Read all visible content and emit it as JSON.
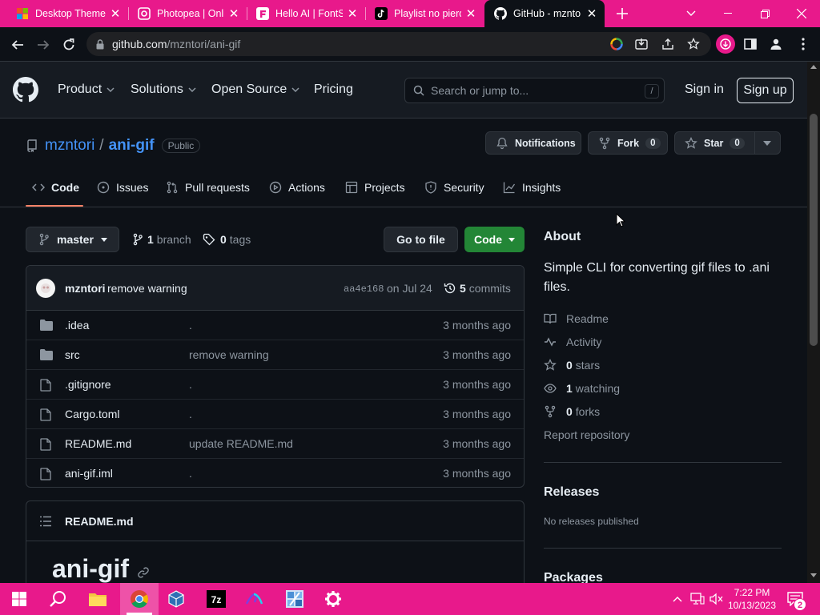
{
  "browser": {
    "tabs": [
      {
        "title": "Desktop Theme",
        "icon": "microsoft-icon"
      },
      {
        "title": "Photopea | Onli",
        "icon": "photopea-icon"
      },
      {
        "title": "Hello AI | FontSl",
        "icon": "fontspace-icon"
      },
      {
        "title": "Playlist no pierd",
        "icon": "tiktok-icon"
      },
      {
        "title": "GitHub - mznto",
        "icon": "github-icon",
        "active": true
      }
    ],
    "url_host": "github.com",
    "url_path": "/mzntori/ani-gif"
  },
  "gh_header": {
    "nav": [
      "Product",
      "Solutions",
      "Open Source",
      "Pricing"
    ],
    "search_placeholder": "Search or jump to...",
    "search_key": "/",
    "sign_in": "Sign in",
    "sign_up": "Sign up"
  },
  "repo": {
    "owner": "mzntori",
    "separator": "/",
    "name": "ani-gif",
    "visibility": "Public",
    "notifications_label": "Notifications",
    "fork_label": "Fork",
    "fork_count": "0",
    "star_label": "Star",
    "star_count": "0",
    "tabs": [
      "Code",
      "Issues",
      "Pull requests",
      "Actions",
      "Projects",
      "Security",
      "Insights"
    ]
  },
  "files": {
    "branch": "master",
    "branch_count": "1",
    "branch_label": "branch",
    "tag_count": "0",
    "tag_label": "tags",
    "go_to_file": "Go to file",
    "code_button": "Code",
    "commit": {
      "author": "mzntori",
      "message": "remove warning",
      "hash": "aa4e168",
      "date": "on Jul 24",
      "count": "5",
      "count_label": "commits"
    },
    "rows": [
      {
        "type": "folder",
        "name": ".idea",
        "message": ".",
        "age": "3 months ago"
      },
      {
        "type": "folder",
        "name": "src",
        "message": "remove warning",
        "age": "3 months ago"
      },
      {
        "type": "file",
        "name": ".gitignore",
        "message": ".",
        "age": "3 months ago"
      },
      {
        "type": "file",
        "name": "Cargo.toml",
        "message": ".",
        "age": "3 months ago"
      },
      {
        "type": "file",
        "name": "README.md",
        "message": "update README.md",
        "age": "3 months ago"
      },
      {
        "type": "file",
        "name": "ani-gif.iml",
        "message": ".",
        "age": "3 months ago"
      }
    ],
    "readme_file": "README.md",
    "readme_title": "ani-gif"
  },
  "about": {
    "heading": "About",
    "description": "Simple CLI for converting gif files to .ani files.",
    "readme": "Readme",
    "activity": "Activity",
    "stars_count": "0",
    "stars_label": "stars",
    "watching_count": "1",
    "watching_label": "watching",
    "forks_count": "0",
    "forks_label": "forks",
    "report": "Report repository",
    "releases_heading": "Releases",
    "releases_text": "No releases published",
    "packages_heading": "Packages"
  },
  "taskbar": {
    "time": "7:22 PM",
    "date": "10/13/2023",
    "notification_count": "2",
    "apps": [
      "start-icon",
      "search-icon",
      "file-explorer-icon",
      "chrome-icon",
      "virtualbox-icon",
      "7zip-icon",
      "app-icon",
      "app-icon",
      "settings-icon"
    ]
  },
  "colors": {
    "accent_pink": "#e8198b",
    "link_blue": "#4493f8",
    "green_button": "#238636",
    "bg": "#0d1117"
  }
}
